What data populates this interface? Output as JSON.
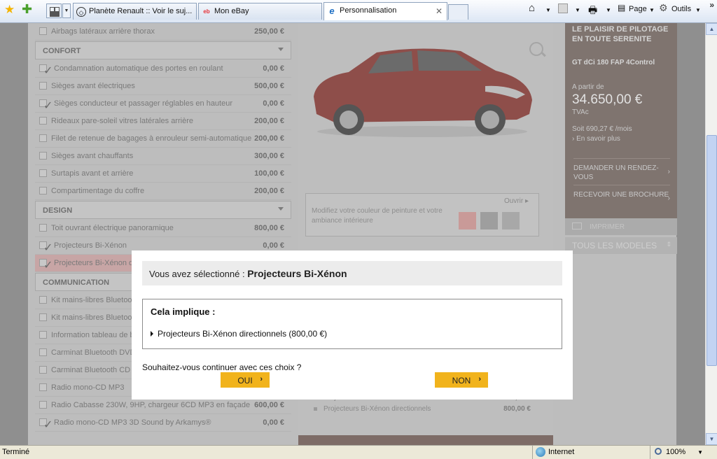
{
  "browser": {
    "tabs": [
      {
        "label": "Planète Renault :: Voir le suj...",
        "icon": "renault-icon"
      },
      {
        "label": "Mon eBay",
        "icon": "ebay-icon"
      },
      {
        "label": "Personnalisation",
        "icon": "ie-icon"
      }
    ],
    "tools": {
      "page_label": "Page",
      "tools_label": "Outils"
    }
  },
  "options": {
    "top_item": {
      "label": "Airbags latéraux arrière thorax",
      "price": "250,00 €"
    },
    "confort": {
      "title": "CONFORT",
      "items": [
        {
          "label": "Condamnation automatique des portes en roulant",
          "price": "0,00 €",
          "checked": true
        },
        {
          "label": "Sièges avant électriques",
          "price": "500,00 €",
          "checked": false
        },
        {
          "label": "Sièges conducteur et passager réglables en hauteur",
          "price": "0,00 €",
          "checked": true
        },
        {
          "label": "Rideaux pare-soleil vitres latérales arrière",
          "price": "200,00 €",
          "checked": false
        },
        {
          "label": "Filet de retenue de bagages à enrouleur semi-automatique",
          "price": "200,00 €",
          "checked": false
        },
        {
          "label": "Sièges avant chauffants",
          "price": "300,00 €",
          "checked": false
        },
        {
          "label": "Surtapis avant et arrière",
          "price": "100,00 €",
          "checked": false
        },
        {
          "label": "Compartimentage du coffre",
          "price": "200,00 €",
          "checked": false
        }
      ]
    },
    "design": {
      "title": "DESIGN",
      "items": [
        {
          "label": "Toit ouvrant électrique panoramique",
          "price": "800,00 €",
          "checked": false
        },
        {
          "label": "Projecteurs Bi-Xénon",
          "price": "0,00 €",
          "checked": true
        },
        {
          "label": "Projecteurs Bi-Xénon d",
          "price": "",
          "checked": true
        }
      ]
    },
    "communication": {
      "title": "COMMUNICATION",
      "items": [
        {
          "label": "Kit mains-libres Bluetoot",
          "price": "",
          "checked": false
        },
        {
          "label": "Kit mains-libres Bluetoot",
          "price": "",
          "checked": false
        },
        {
          "label": "Information tableau de b",
          "price": "",
          "checked": false
        },
        {
          "label": "Carminat Bluetooth DVD",
          "price": "",
          "checked": false
        },
        {
          "label": "Carminat Bluetooth CD A",
          "price": "",
          "checked": false
        },
        {
          "label": "Radio mono-CD MP3",
          "price": "",
          "checked": false
        },
        {
          "label": "Radio Cabasse 230W, 9HP, chargeur 6CD MP3 en façade",
          "price": "600,00 €",
          "checked": false
        },
        {
          "label": "Radio mono-CD MP3 3D Sound by Arkamys®",
          "price": "0,00 €",
          "checked": true
        }
      ]
    }
  },
  "paint": {
    "open_label": "Ouvrir",
    "text": "Modifiez votre couleur de peinture et votre ambiance intérieure",
    "swatch_colors": [
      "#c99a98",
      "#9e9e9e",
      "#a8a8a8"
    ]
  },
  "summary": [
    {
      "label": "Projecteurs Bi-Xénon",
      "price": "0,00 €"
    },
    {
      "label": "Projecteurs Bi-Xénon directionnels",
      "price": "800,00 €"
    }
  ],
  "side": {
    "title": "LE PLAISIR DE PILOTAGE EN TOUTE SERENITE",
    "model": "GT dCi 180 FAP 4Control",
    "from_label": "A partir de",
    "price": "34.650,00 €",
    "tva": "TVAc",
    "monthly": "Soit 690,27 € /mois",
    "more": "› En savoir plus",
    "links": [
      "DEMANDER UN RENDEZ-VOUS",
      "RECEVOIR UNE BROCHURE"
    ],
    "print": "IMPRIMER",
    "all_models": "TOUS LES MODELES"
  },
  "modal": {
    "selected_prefix": "Vous avez sélectionné : ",
    "selected_item": "Projecteurs Bi-Xénon",
    "implies_title": "Cela implique :",
    "implied_item": "Projecteurs Bi-Xénon directionnels (800,00 €)",
    "question": "Souhaitez-vous continuer avec ces choix ?",
    "yes_label": "OUI",
    "no_label": "NON"
  },
  "status": {
    "text": "Terminé",
    "zone": "Internet",
    "zoom": "100%"
  }
}
